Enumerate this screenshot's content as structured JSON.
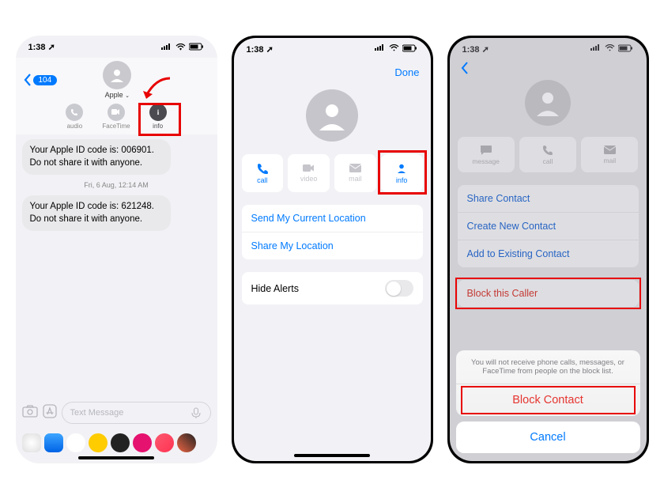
{
  "status": {
    "time": "1:38",
    "arrow": "➚"
  },
  "phone1": {
    "back_count": "104",
    "contact_name": "Apple",
    "actions": {
      "audio": "audio",
      "facetime": "FaceTime",
      "info": "info"
    },
    "msg1": "Your Apple ID code is: 006901. Do not share it with anyone.",
    "timestamp": "Fri, 6 Aug, 12:14 AM",
    "msg2": "Your Apple ID code is: 621248. Do not share it with anyone.",
    "input_placeholder": "Text Message"
  },
  "phone2": {
    "done": "Done",
    "actions": {
      "call": "call",
      "video": "video",
      "mail": "mail",
      "info": "info"
    },
    "send_location": "Send My Current Location",
    "share_location": "Share My Location",
    "hide_alerts": "Hide Alerts"
  },
  "phone3": {
    "actions": {
      "message": "message",
      "call": "call",
      "mail": "mail"
    },
    "share_contact": "Share Contact",
    "create_contact": "Create New Contact",
    "add_existing": "Add to Existing Contact",
    "block_caller": "Block this Caller",
    "sheet_msg": "You will not receive phone calls, messages, or FaceTime from people on the block list.",
    "block_contact": "Block Contact",
    "cancel": "Cancel"
  }
}
